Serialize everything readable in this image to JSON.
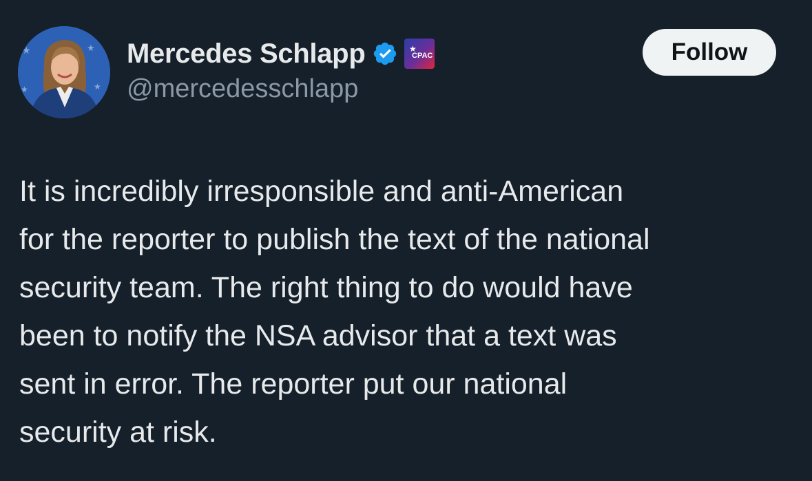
{
  "author": {
    "display_name": "Mercedes Schlapp",
    "handle": "@mercedesschlapp",
    "avatar_icon": "profile-photo",
    "verified_icon": "verified-badge-icon",
    "affiliate_badge_icon": "cpac-affiliate-badge",
    "affiliate_badge_text": "CPAC"
  },
  "follow_label": "Follow",
  "tweet": {
    "lines": [
      "It is incredibly irresponsible and anti-American",
      "for the reporter to publish the text of the national",
      "security team. The right thing to do would have",
      "been to notify the NSA advisor that a text was",
      "sent in error. The reporter put our national",
      "security at risk."
    ]
  },
  "colors": {
    "background": "#15202b",
    "text_primary": "#e7e9ea",
    "text_secondary": "#8b98a5",
    "verified_blue": "#1d9bf0",
    "follow_bg": "#eff3f4"
  }
}
